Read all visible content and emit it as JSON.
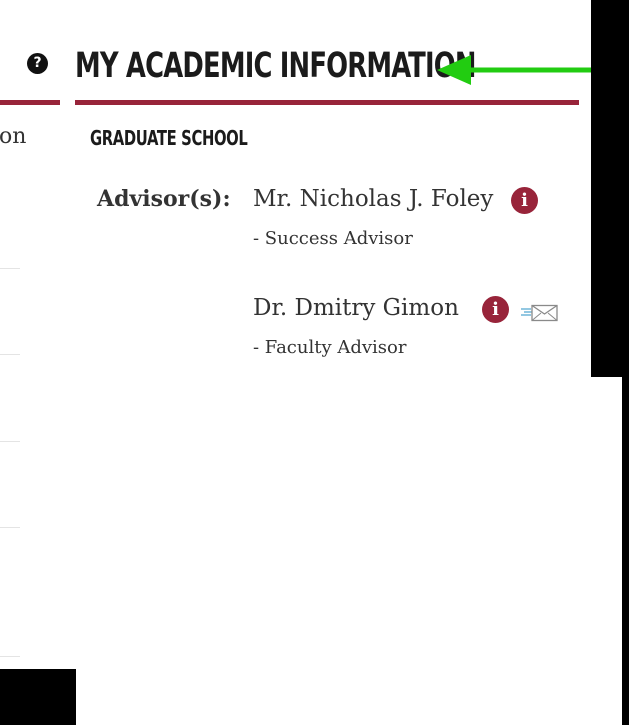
{
  "header": {
    "title": "MY ACADEMIC INFORMATION",
    "help_glyph": "?"
  },
  "left_panel": {
    "text": "ion"
  },
  "section": {
    "title": "GRADUATE SCHOOL"
  },
  "advisors": {
    "label": "Advisor(s):",
    "items": [
      {
        "name": "Mr. Nicholas J. Foley",
        "role": "- Success Advisor",
        "info_icon": "info-icon",
        "email_icon": null
      },
      {
        "name": "Dr. Dmitry Gimon",
        "role": "- Faculty Advisor",
        "info_icon": "info-icon",
        "email_icon": "email-icon"
      }
    ],
    "info_glyph": "i"
  },
  "colors": {
    "accent": "#98243a",
    "annotation_arrow": "#22cc11",
    "backdrop": "#000000"
  },
  "icons": {
    "help": "question-circle-icon",
    "arrow": "left-arrow-icon"
  }
}
